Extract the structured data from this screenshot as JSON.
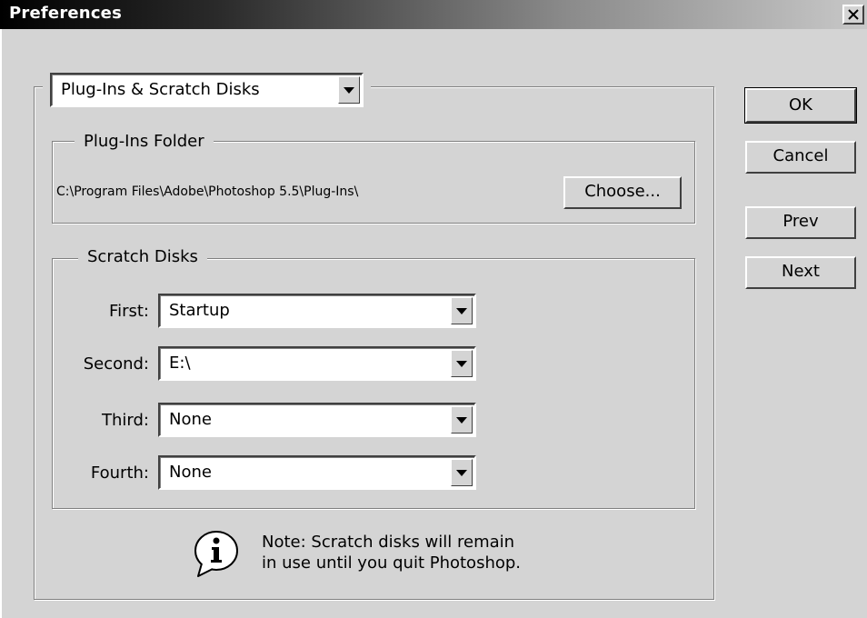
{
  "window": {
    "title": "Preferences",
    "close_glyph": "×"
  },
  "section_select": {
    "value": "Plug-Ins & Scratch Disks"
  },
  "plugins_folder": {
    "legend": "Plug-Ins Folder",
    "path": "C:\\Program Files\\Adobe\\Photoshop 5.5\\Plug-Ins\\",
    "choose_label": "Choose..."
  },
  "scratch_disks": {
    "legend": "Scratch Disks",
    "rows": [
      {
        "label": "First:",
        "value": "Startup"
      },
      {
        "label": "Second:",
        "value": "E:\\"
      },
      {
        "label": "Third:",
        "value": "None"
      },
      {
        "label": "Fourth:",
        "value": "None"
      }
    ]
  },
  "note": {
    "line1": "Note: Scratch disks will remain",
    "line2": "in use until you quit Photoshop."
  },
  "buttons": {
    "ok": "OK",
    "cancel": "Cancel",
    "prev": "Prev",
    "next": "Next"
  }
}
